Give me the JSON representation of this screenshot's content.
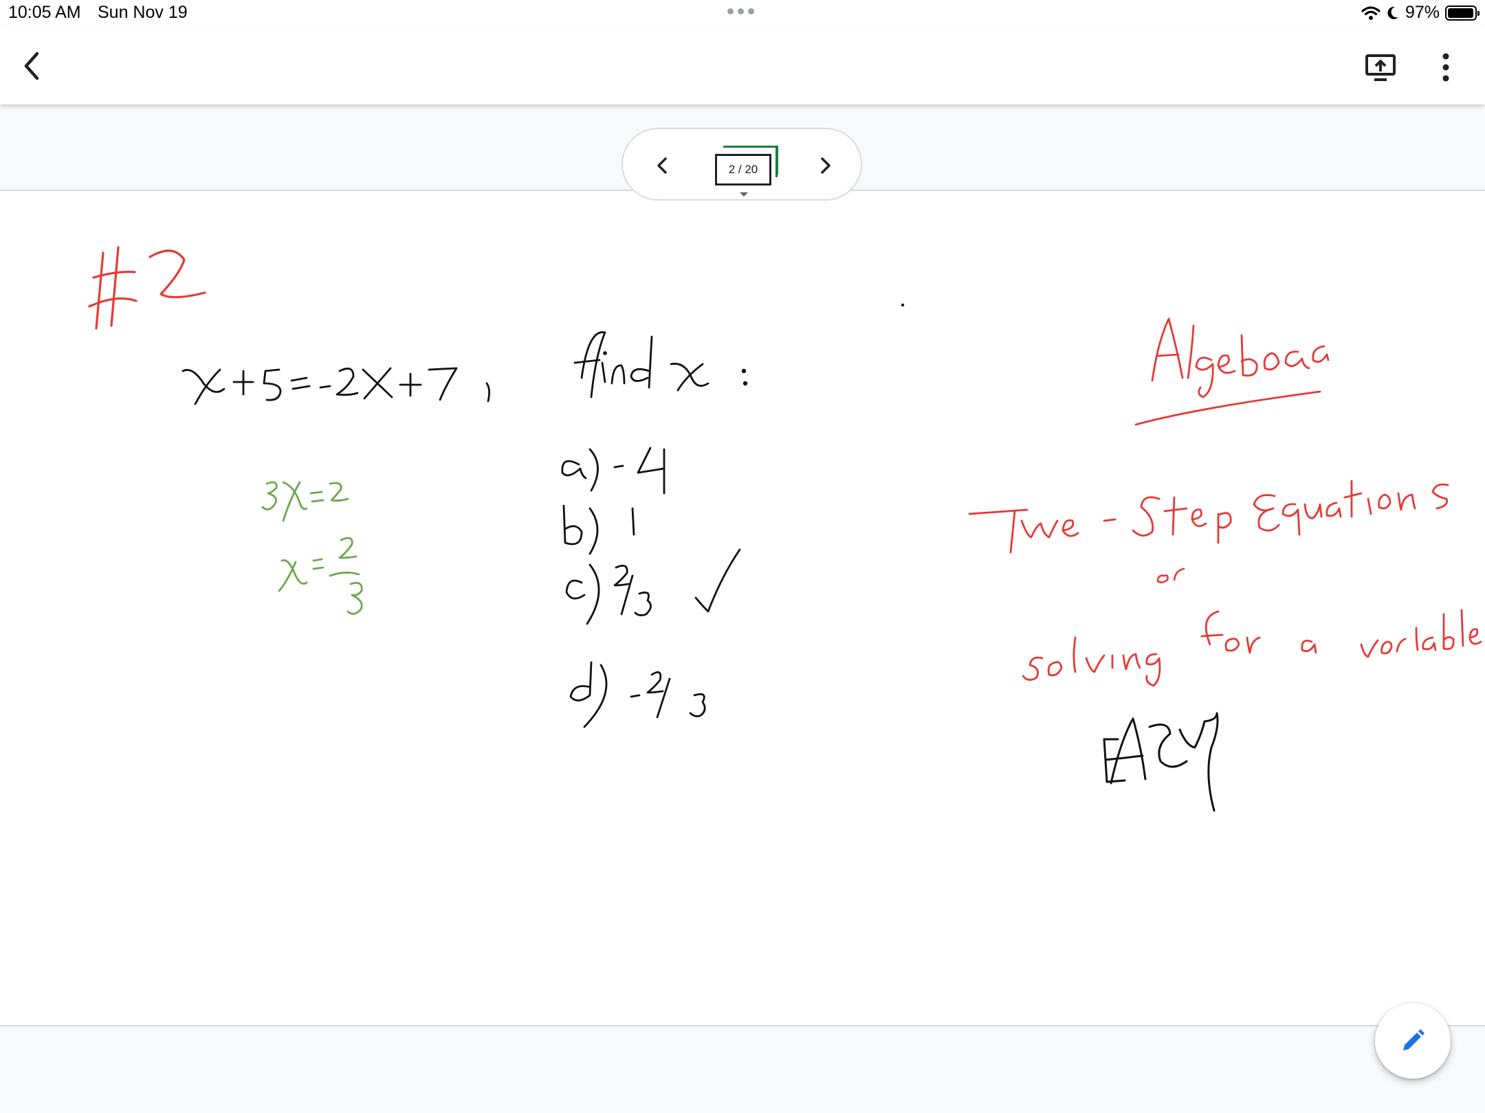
{
  "status_bar": {
    "time": "10:05 AM",
    "date": "Sun Nov 19",
    "battery_percent": "97%",
    "battery_level": 0.97,
    "icons": [
      "wifi-icon",
      "moon-icon",
      "battery-icon"
    ]
  },
  "app_bar": {
    "back_icon": "chevron-left-icon",
    "present_icon": "present-screen-icon",
    "more_icon": "more-vert-icon"
  },
  "pager": {
    "prev_icon": "chevron-left-icon",
    "next_icon": "chevron-right-icon",
    "page_label": "2 / 20",
    "current_page": 2,
    "total_pages": 20
  },
  "slide": {
    "problem_number": "#2",
    "equation": "x+5=-2x+7",
    "prompt": "find x :",
    "work_lines": [
      "3x=2",
      "x=2/3"
    ],
    "options": [
      {
        "label": "a)",
        "value": "-4"
      },
      {
        "label": "b)",
        "value": "1"
      },
      {
        "label": "c)",
        "value": "2/3",
        "checked": true
      },
      {
        "label": "d)",
        "value": "-2/3"
      }
    ],
    "subject": "Algebra",
    "topic_line1": "Two-Step Equations",
    "topic_or": "or",
    "topic_line2": "solving for a variable",
    "difficulty": "EASY",
    "colors": {
      "red": "#e53935",
      "green": "#6aa84f",
      "black": "#111111"
    }
  },
  "fab": {
    "icon": "pencil-icon",
    "color": "#1a73e8"
  }
}
